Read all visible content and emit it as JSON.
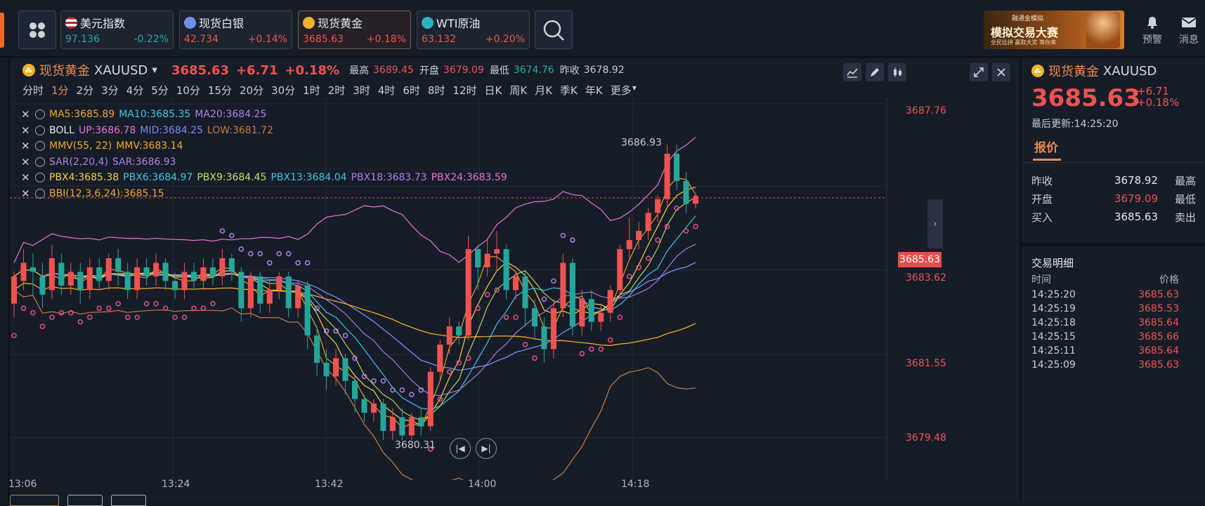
{
  "tickers": [
    {
      "name": "美元指数",
      "price": "97.136",
      "change": "-0.22%",
      "dir": "dn",
      "flag": "us"
    },
    {
      "name": "现货白银",
      "price": "42.734",
      "change": "+0.14%",
      "dir": "up",
      "flag": "silver"
    },
    {
      "name": "现货黄金",
      "price": "3685.63",
      "change": "+0.18%",
      "dir": "up",
      "flag": "gold"
    },
    {
      "name": "WTI原油",
      "price": "63.132",
      "change": "+0.20%",
      "dir": "up",
      "flag": "oil"
    }
  ],
  "banner": {
    "title": "模拟交易大赛",
    "sub": "融通金模拟",
    "note": "全民比拼 赢取大奖 等你来"
  },
  "top_actions": {
    "alert": "预警",
    "message": "消息"
  },
  "header": {
    "name": "现货黄金",
    "symbol": "XAUUSD",
    "price": "3685.63",
    "change": "+6.71",
    "pct": "+0.18%",
    "high_label": "最高",
    "high": "3689.45",
    "open_label": "开盘",
    "open": "3679.09",
    "low_label": "最低",
    "low": "3674.76",
    "prev_label": "昨收",
    "prev": "3678.92"
  },
  "periods": [
    "分时",
    "1分",
    "2分",
    "3分",
    "4分",
    "5分",
    "10分",
    "15分",
    "20分",
    "30分",
    "1时",
    "2时",
    "3时",
    "4时",
    "6时",
    "8时",
    "12时",
    "日K",
    "周K",
    "月K",
    "季K",
    "年K",
    "更多"
  ],
  "selected_period": "1分",
  "indicators": [
    {
      "parts": [
        {
          "t": "MA5:3685.89",
          "c": "#f5a623"
        },
        {
          "t": "MA10:3685.35",
          "c": "#3ec6e0"
        },
        {
          "t": "MA20:3684.25",
          "c": "#b07fe8"
        }
      ]
    },
    {
      "parts": [
        {
          "t": "BOLL",
          "c": "#e6e9ef"
        },
        {
          "t": "UP:3686.78",
          "c": "#e872d6"
        },
        {
          "t": "MID:3684.25",
          "c": "#7b8cf0"
        },
        {
          "t": "LOW:3681.72",
          "c": "#c97b3a"
        }
      ]
    },
    {
      "parts": [
        {
          "t": "MMV(55, 22)",
          "c": "#f5a623"
        },
        {
          "t": "MMV:3683.14",
          "c": "#f5a623"
        }
      ]
    },
    {
      "parts": [
        {
          "t": "SAR(2,20,4)",
          "c": "#b07fe8"
        },
        {
          "t": "SAR:3686.93",
          "c": "#b07fe8"
        }
      ]
    },
    {
      "parts": [
        {
          "t": "PBX4:3685.38",
          "c": "#f5d142"
        },
        {
          "t": "PBX6:3684.97",
          "c": "#3ec6e0"
        },
        {
          "t": "PBX9:3684.45",
          "c": "#c6e05a"
        },
        {
          "t": "PBX13:3684.04",
          "c": "#3ec6e0"
        },
        {
          "t": "PBX18:3683.73",
          "c": "#b07fe8"
        },
        {
          "t": "PBX24:3683.59",
          "c": "#e872d6"
        }
      ]
    },
    {
      "parts": [
        {
          "t": "BBI(12,3,6,24):3685.15",
          "c": "#f5a623"
        }
      ]
    }
  ],
  "y_labels": [
    "3687.76",
    "3685.63",
    "3683.62",
    "3681.55",
    "3679.48"
  ],
  "x_labels": [
    "13:06",
    "13:24",
    "13:42",
    "14:00",
    "14:18"
  ],
  "annotations": {
    "high": "3686.93",
    "low": "3680.31"
  },
  "right_panel": {
    "name": "现货黄金",
    "symbol": "XAUUSD",
    "price": "3685.63",
    "change": "+6.71",
    "pct": "+0.18%",
    "updated": "最后更新:14:25:20",
    "tab": "报价",
    "quotes": [
      {
        "k": "昨收",
        "v": "3678.92",
        "c": "#e6e9ef",
        "k2": "最高"
      },
      {
        "k": "开盘",
        "v": "3679.09",
        "c": "#ef5350",
        "k2": "最低"
      },
      {
        "k": "买入",
        "v": "3685.63",
        "c": "#e6e9ef",
        "k2": "卖出"
      }
    ],
    "trades_title": "交易明细",
    "col_time": "时间",
    "col_price": "价格",
    "trades": [
      {
        "t": "14:25:20",
        "p": "3685.63"
      },
      {
        "t": "14:25:19",
        "p": "3685.53"
      },
      {
        "t": "14:25:18",
        "p": "3685.64"
      },
      {
        "t": "14:25:15",
        "p": "3685.66"
      },
      {
        "t": "14:25:11",
        "p": "3685.64"
      },
      {
        "t": "14:25:09",
        "p": "3685.63"
      }
    ]
  },
  "colors": {
    "up": "#ef5350",
    "down": "#26a69a",
    "accent": "#ef8a4a"
  },
  "chart_data": {
    "type": "candlestick",
    "ylim": [
      3679.48,
      3687.76
    ],
    "x_ticks": [
      "13:06",
      "13:24",
      "13:42",
      "14:00",
      "14:18"
    ],
    "candles": [
      [
        3683.3,
        3683.9,
        3683.0,
        3684.0
      ],
      [
        3683.8,
        3684.2,
        3683.6,
        3684.5
      ],
      [
        3684.1,
        3684.0,
        3683.5,
        3684.4
      ],
      [
        3683.9,
        3683.5,
        3683.2,
        3684.2
      ],
      [
        3683.6,
        3684.3,
        3683.4,
        3684.6
      ],
      [
        3684.2,
        3683.7,
        3683.5,
        3684.4
      ],
      [
        3683.7,
        3684.0,
        3683.5,
        3684.2
      ],
      [
        3684.0,
        3683.6,
        3683.3,
        3684.2
      ],
      [
        3683.6,
        3684.1,
        3683.4,
        3684.3
      ],
      [
        3684.1,
        3683.8,
        3683.6,
        3684.3
      ],
      [
        3683.8,
        3684.3,
        3683.6,
        3684.4
      ],
      [
        3684.3,
        3684.0,
        3683.7,
        3684.5
      ],
      [
        3684.0,
        3683.6,
        3683.4,
        3684.2
      ],
      [
        3683.6,
        3684.1,
        3683.4,
        3684.3
      ],
      [
        3684.1,
        3683.9,
        3683.7,
        3684.3
      ],
      [
        3683.9,
        3684.2,
        3683.7,
        3684.4
      ],
      [
        3684.2,
        3683.8,
        3683.6,
        3684.3
      ],
      [
        3683.8,
        3683.6,
        3683.4,
        3684.0
      ],
      [
        3683.6,
        3684.0,
        3683.4,
        3684.2
      ],
      [
        3684.0,
        3683.8,
        3683.6,
        3684.2
      ],
      [
        3683.8,
        3684.1,
        3683.6,
        3684.3
      ],
      [
        3684.1,
        3683.9,
        3683.7,
        3684.3
      ],
      [
        3683.9,
        3684.3,
        3683.7,
        3684.5
      ],
      [
        3684.3,
        3684.0,
        3683.8,
        3684.4
      ],
      [
        3684.0,
        3683.2,
        3682.9,
        3684.1
      ],
      [
        3683.2,
        3683.9,
        3683.0,
        3684.0
      ],
      [
        3683.9,
        3683.3,
        3683.1,
        3684.0
      ],
      [
        3683.3,
        3683.6,
        3683.1,
        3683.8
      ],
      [
        3683.6,
        3683.9,
        3683.4,
        3684.0
      ],
      [
        3683.9,
        3683.2,
        3683.0,
        3684.0
      ],
      [
        3683.2,
        3683.7,
        3683.0,
        3683.8
      ],
      [
        3683.7,
        3682.6,
        3682.3,
        3683.8
      ],
      [
        3682.6,
        3682.0,
        3681.7,
        3682.8
      ],
      [
        3682.0,
        3681.7,
        3681.4,
        3682.3
      ],
      [
        3681.7,
        3682.1,
        3681.5,
        3682.3
      ],
      [
        3682.1,
        3681.6,
        3681.3,
        3682.2
      ],
      [
        3681.6,
        3681.2,
        3680.9,
        3681.7
      ],
      [
        3681.2,
        3680.9,
        3680.7,
        3681.3
      ],
      [
        3680.9,
        3681.1,
        3680.7,
        3681.2
      ],
      [
        3681.1,
        3680.5,
        3680.3,
        3681.2
      ],
      [
        3680.5,
        3680.8,
        3680.3,
        3681.0
      ],
      [
        3680.8,
        3680.4,
        3680.3,
        3681.0
      ],
      [
        3680.4,
        3680.8,
        3680.3,
        3680.9
      ],
      [
        3680.8,
        3680.6,
        3680.4,
        3681.0
      ],
      [
        3680.6,
        3681.8,
        3680.5,
        3681.9
      ],
      [
        3681.8,
        3682.4,
        3681.6,
        3682.5
      ],
      [
        3682.4,
        3682.8,
        3682.2,
        3683.0
      ],
      [
        3682.8,
        3682.6,
        3682.4,
        3682.9
      ],
      [
        3682.6,
        3684.5,
        3682.5,
        3684.8
      ],
      [
        3684.5,
        3684.1,
        3683.6,
        3684.6
      ],
      [
        3684.1,
        3684.4,
        3683.9,
        3684.7
      ],
      [
        3684.4,
        3684.5,
        3684.0,
        3684.9
      ],
      [
        3684.5,
        3683.6,
        3683.4,
        3684.6
      ],
      [
        3683.6,
        3683.9,
        3683.4,
        3684.0
      ],
      [
        3683.9,
        3683.2,
        3682.8,
        3684.0
      ],
      [
        3683.2,
        3682.8,
        3682.5,
        3683.4
      ],
      [
        3682.8,
        3682.3,
        3682.0,
        3683.0
      ],
      [
        3682.3,
        3683.2,
        3682.1,
        3683.4
      ],
      [
        3683.2,
        3684.2,
        3683.0,
        3684.4
      ],
      [
        3684.2,
        3682.8,
        3682.6,
        3684.3
      ],
      [
        3682.8,
        3683.4,
        3682.6,
        3683.6
      ],
      [
        3683.4,
        3682.9,
        3682.7,
        3683.6
      ],
      [
        3682.9,
        3683.1,
        3682.7,
        3683.3
      ],
      [
        3683.1,
        3683.6,
        3682.9,
        3683.7
      ],
      [
        3683.6,
        3684.5,
        3683.4,
        3684.6
      ],
      [
        3684.5,
        3684.7,
        3684.3,
        3685.2
      ],
      [
        3684.7,
        3684.9,
        3684.5,
        3685.1
      ],
      [
        3684.9,
        3685.3,
        3684.7,
        3685.4
      ],
      [
        3685.3,
        3685.6,
        3685.1,
        3685.7
      ],
      [
        3685.6,
        3686.6,
        3685.4,
        3686.8
      ],
      [
        3686.6,
        3686.0,
        3685.8,
        3686.8
      ],
      [
        3686.0,
        3685.5,
        3685.3,
        3686.2
      ],
      [
        3685.5,
        3685.63,
        3685.4,
        3685.7
      ]
    ]
  }
}
